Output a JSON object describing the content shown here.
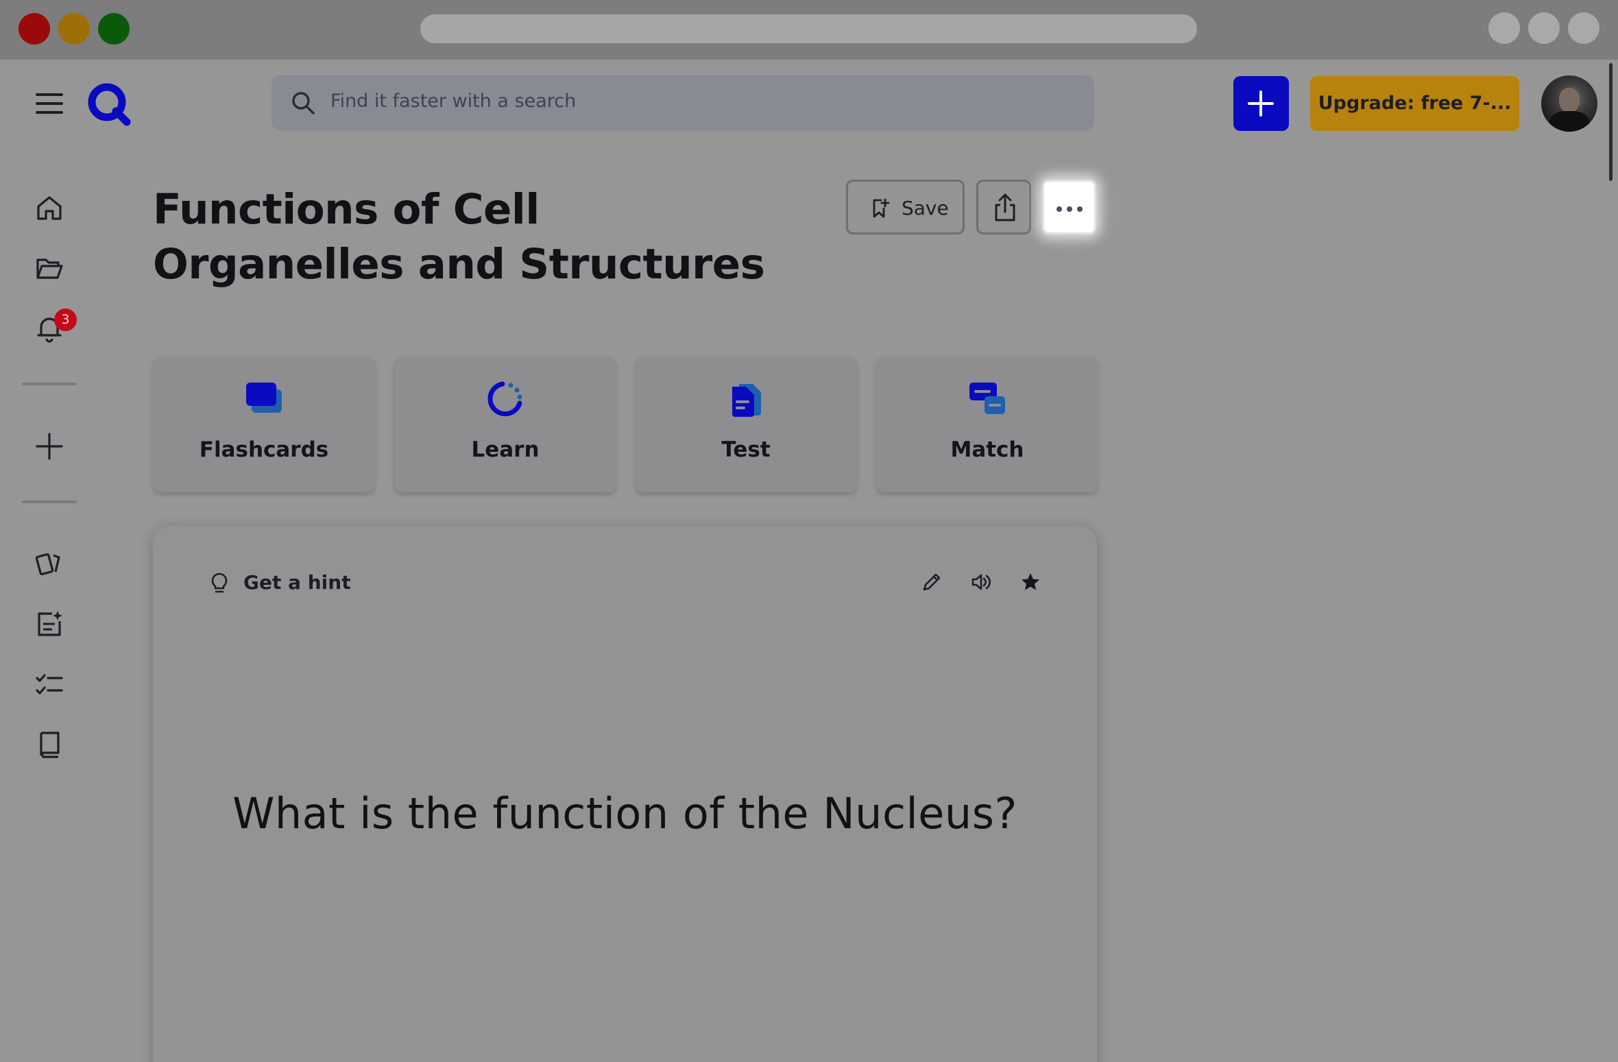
{
  "search": {
    "placeholder": "Find it faster with a search"
  },
  "header": {
    "upgrade_label": "Upgrade: free 7-..."
  },
  "sidebar": {
    "notification_count": "3"
  },
  "set": {
    "title": "Functions of Cell Organelles and Structures",
    "save_label": "Save"
  },
  "modes": [
    {
      "label": "Flashcards",
      "icon": "flashcards-icon"
    },
    {
      "label": "Learn",
      "icon": "learn-icon"
    },
    {
      "label": "Test",
      "icon": "test-icon"
    },
    {
      "label": "Match",
      "icon": "match-icon"
    }
  ],
  "flashcard": {
    "hint_label": "Get a hint",
    "term": "What is the function of the Nucleus?"
  },
  "colors": {
    "accent": "#0a0ac0",
    "upgrade": "#b8830c",
    "badge": "#c40a1a"
  }
}
